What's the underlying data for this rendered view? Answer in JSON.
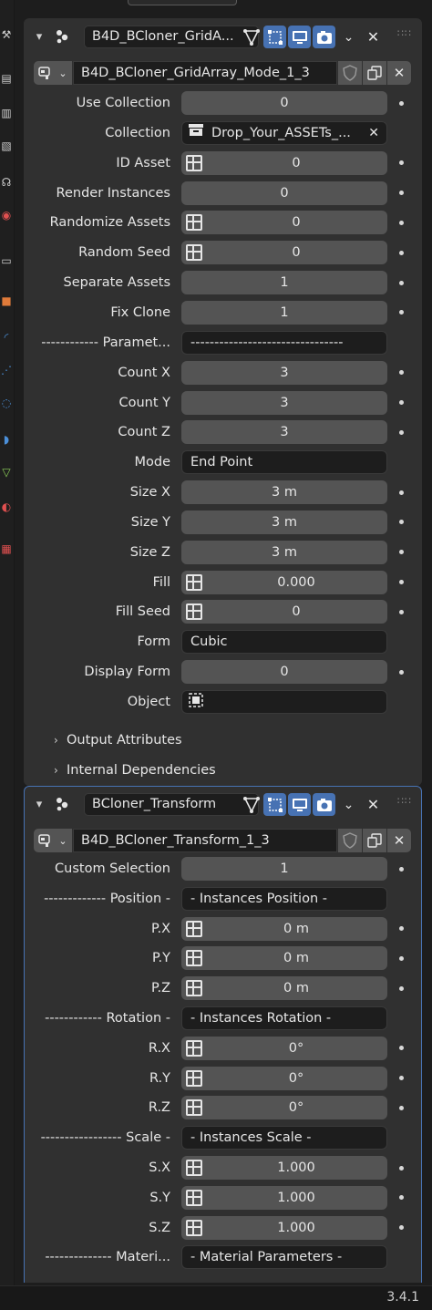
{
  "status_bar": {
    "version": "3.4.1"
  },
  "panel1": {
    "modifier_name": "B4D_BCloner_GridA...",
    "node_group": "B4D_BCloner_GridArray_Mode_1_3",
    "rows": [
      {
        "label": "Use Collection",
        "value": "0",
        "kind": "num",
        "kf": true
      },
      {
        "label": "Collection",
        "value": "Drop_Your_ASSETs_...",
        "kind": "collection",
        "kf": false
      },
      {
        "label": "ID Asset",
        "value": "0",
        "kind": "attr",
        "kf": true
      },
      {
        "label": "Render Instances",
        "value": "0",
        "kind": "num",
        "kf": true
      },
      {
        "label": "Randomize Assets",
        "value": "0",
        "kind": "attr",
        "kf": true
      },
      {
        "label": "Random Seed",
        "value": "0",
        "kind": "attr",
        "kf": true
      },
      {
        "label": "Separate Assets",
        "value": "1",
        "kind": "num",
        "kf": true
      },
      {
        "label": "Fix Clone",
        "value": "1",
        "kind": "num",
        "kf": true
      },
      {
        "label": "------------ Paramet...",
        "value": "--------------------------------",
        "kind": "text",
        "kf": false
      },
      {
        "label": "Count X",
        "value": "3",
        "kind": "num",
        "kf": true
      },
      {
        "label": "Count Y",
        "value": "3",
        "kind": "num",
        "kf": true
      },
      {
        "label": "Count Z",
        "value": "3",
        "kind": "num",
        "kf": true
      },
      {
        "label": "Mode",
        "value": "End Point",
        "kind": "text",
        "kf": false
      },
      {
        "label": "Size X",
        "value": "3 m",
        "kind": "num",
        "kf": true
      },
      {
        "label": "Size Y",
        "value": "3 m",
        "kind": "num",
        "kf": true
      },
      {
        "label": "Size Z",
        "value": "3 m",
        "kind": "num",
        "kf": true
      },
      {
        "label": "Fill",
        "value": "0.000",
        "kind": "attr",
        "kf": true
      },
      {
        "label": "Fill Seed",
        "value": "0",
        "kind": "attr",
        "kf": true
      },
      {
        "label": "Form",
        "value": "Cubic",
        "kind": "text",
        "kf": false
      },
      {
        "label": "Display Form",
        "value": "0",
        "kind": "num",
        "kf": true
      },
      {
        "label": "Object",
        "value": "",
        "kind": "object",
        "kf": false
      }
    ],
    "subpanels": [
      "Output Attributes",
      "Internal Dependencies"
    ]
  },
  "panel2": {
    "modifier_name": "BCloner_Transform",
    "node_group": "B4D_BCloner_Transform_1_3",
    "rows": [
      {
        "label": "Custom Selection",
        "value": "1",
        "kind": "num",
        "kf": true
      },
      {
        "label": "------------- Position -",
        "value": "- Instances Position -",
        "kind": "text",
        "kf": false
      },
      {
        "label": "P.X",
        "value": "0 m",
        "kind": "attr",
        "kf": true
      },
      {
        "label": "P.Y",
        "value": "0 m",
        "kind": "attr",
        "kf": true
      },
      {
        "label": "P.Z",
        "value": "0 m",
        "kind": "attr",
        "kf": true
      },
      {
        "label": "------------ Rotation -",
        "value": "- Instances Rotation -",
        "kind": "text",
        "kf": false
      },
      {
        "label": "R.X",
        "value": "0°",
        "kind": "attr",
        "kf": true
      },
      {
        "label": "R.Y",
        "value": "0°",
        "kind": "attr",
        "kf": true
      },
      {
        "label": "R.Z",
        "value": "0°",
        "kind": "attr",
        "kf": true
      },
      {
        "label": "----------------- Scale -",
        "value": "- Instances Scale -",
        "kind": "text",
        "kf": false
      },
      {
        "label": "S.X",
        "value": "1.000",
        "kind": "attr",
        "kf": true
      },
      {
        "label": "S.Y",
        "value": "1.000",
        "kind": "attr",
        "kf": true
      },
      {
        "label": "S.Z",
        "value": "1.000",
        "kind": "attr",
        "kf": true
      },
      {
        "label": "-------------- Materi...",
        "value": "- Material Parameters -",
        "kind": "text",
        "kf": false
      }
    ]
  },
  "icons": {
    "collapse": "chevron-down-icon",
    "geometry_nodes": "geometry-nodes-icon",
    "edit_mode": "vertex-triangle-icon",
    "cage": "cage-icon",
    "realtime": "monitor-icon",
    "render": "camera-icon",
    "menu": "chevron-down-icon",
    "delete": "close-icon",
    "drag": "drag-handle-icon",
    "fake_user": "shield-icon",
    "duplicate": "duplicate-icon",
    "unlink": "close-icon",
    "attribute_toggle": "attribute-toggle-icon",
    "collection": "collection-icon",
    "object": "object-eyedropper-icon"
  },
  "colors": {
    "panel": "#303030",
    "field": "#545454",
    "dark_field": "#1d1d1d",
    "accent": "#4772b3",
    "active_outline": "#4772b3"
  }
}
